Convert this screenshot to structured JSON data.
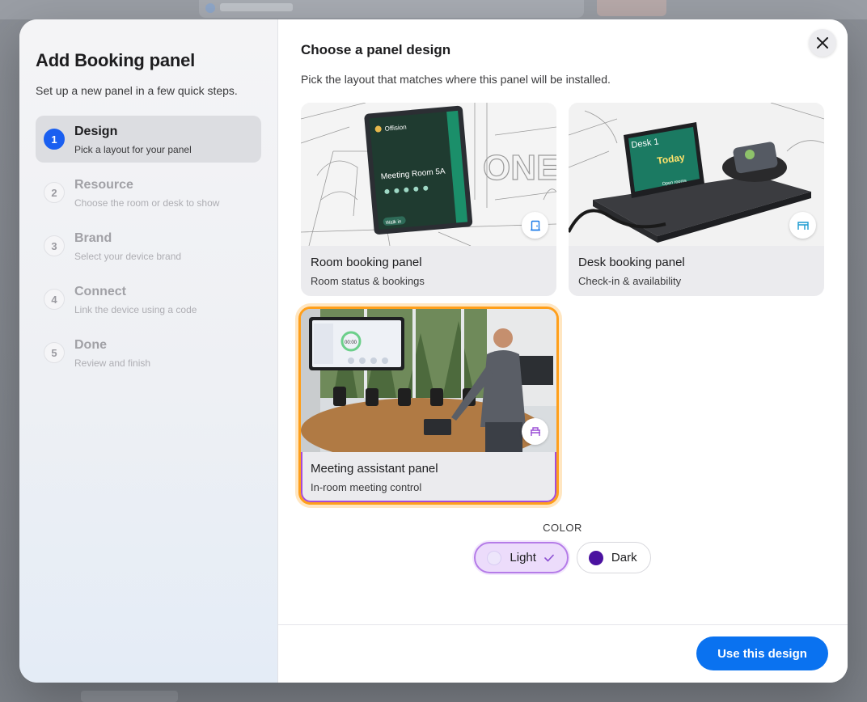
{
  "modal": {
    "title": "Add Booking panel",
    "subtitle": "Set up a new panel in a few quick steps."
  },
  "steps": [
    {
      "number": "1",
      "name": "Design",
      "desc": "Pick a layout for your panel",
      "active": true
    },
    {
      "number": "2",
      "name": "Resource",
      "desc": "Choose the room or desk to show",
      "active": false
    },
    {
      "number": "3",
      "name": "Brand",
      "desc": "Select your device brand",
      "active": false
    },
    {
      "number": "4",
      "name": "Connect",
      "desc": "Link the device using a code",
      "active": false
    },
    {
      "number": "5",
      "name": "Done",
      "desc": "Review and finish",
      "active": false
    }
  ],
  "main": {
    "title": "Choose a panel design",
    "desc": "Pick the layout that matches where this panel will be installed."
  },
  "cards": [
    {
      "title": "Room booking panel",
      "sub": "Room status & bookings",
      "icon": "door-icon",
      "selected": false,
      "screen": {
        "brand": "Offision",
        "room": "Meeting Room 5A",
        "action": "Walk in"
      }
    },
    {
      "title": "Desk booking panel",
      "sub": "Check-in & availability",
      "icon": "desk-icon",
      "selected": false,
      "screen": {
        "desk": "Desk 1",
        "status": "Today",
        "action": "Open rooms"
      }
    },
    {
      "title": "Meeting assistant panel",
      "sub": "In-room meeting control",
      "icon": "meeting-icon",
      "selected": true,
      "screen": {
        "time": "00:00"
      }
    }
  ],
  "color": {
    "label": "COLOR",
    "options": [
      {
        "label": "Light",
        "swatch": "#ede6fb",
        "selected": true
      },
      {
        "label": "Dark",
        "swatch": "#4b12a0",
        "selected": false
      }
    ]
  },
  "footer": {
    "primary": "Use this design"
  },
  "colors": {
    "accent": "#0a72f0",
    "selected_outline": "#ff9f1a",
    "step_active": "#1a5ff0"
  }
}
